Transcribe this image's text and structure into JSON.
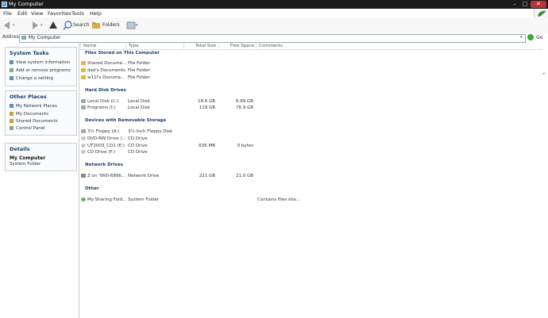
{
  "window": {
    "title": "My Computer"
  },
  "menu": [
    "File",
    "Edit",
    "View",
    "Favorites",
    "Tools",
    "Help"
  ],
  "toolbar": {
    "search_label": "Search",
    "folders_label": "Folders"
  },
  "address": {
    "label": "Address",
    "value": "My Computer",
    "go_label": "Go"
  },
  "left_pane": {
    "system_tasks": {
      "title": "System Tasks",
      "items": [
        "View system information",
        "Add or remove programs",
        "Change a setting"
      ]
    },
    "other_places": {
      "title": "Other Places",
      "items": [
        "My Network Places",
        "My Documents",
        "Shared Documents",
        "Control Panel"
      ]
    },
    "details": {
      "title": "Details",
      "name": "My Computer",
      "type": "System Folder"
    }
  },
  "columns": [
    "Name",
    "Type",
    "Total Size",
    "Free Space",
    "Comments"
  ],
  "groups": [
    {
      "title": "Files Stored on This Computer",
      "rows": [
        {
          "name": "Shared Docume...",
          "type": "File Folder",
          "total": "",
          "free": "",
          "comments": ""
        },
        {
          "name": "dad's Documents",
          "type": "File Folder",
          "total": "",
          "free": "",
          "comments": ""
        },
        {
          "name": "w11l's Docume...",
          "type": "File Folder",
          "total": "",
          "free": "",
          "comments": ""
        }
      ]
    },
    {
      "title": "Hard Disk Drives",
      "rows": [
        {
          "name": "Local Disk (C:)",
          "type": "Local Disk",
          "total": "18.6 GB",
          "free": "6.89 GB",
          "comments": ""
        },
        {
          "name": "Programs (I:)",
          "type": "Local Disk",
          "total": "119 GB",
          "free": "76.9 GB",
          "comments": ""
        }
      ]
    },
    {
      "title": "Devices with Removable Storage",
      "rows": [
        {
          "name": "3½ Floppy (A:)",
          "type": "3½-Inch Floppy Disk",
          "total": "",
          "free": "",
          "comments": ""
        },
        {
          "name": "DVD-RW Drive (...",
          "type": "CD Drive",
          "total": "",
          "free": "",
          "comments": ""
        },
        {
          "name": "UT2003_CD1 (E:)",
          "type": "CD Drive",
          "total": "636 MB",
          "free": "0 bytes",
          "comments": ""
        },
        {
          "name": "CD Drive (F:)",
          "type": "CD Drive",
          "total": "",
          "free": "",
          "comments": ""
        }
      ]
    },
    {
      "title": "Network Drives",
      "rows": [
        {
          "name": "Z on 'Willi-689b...",
          "type": "Network Drive",
          "total": "221 GB",
          "free": "21.0 GB",
          "comments": ""
        }
      ]
    },
    {
      "title": "Other",
      "rows": [
        {
          "name": "My Sharing Fold...",
          "type": "System Folder",
          "total": "",
          "free": "",
          "comments": "Contains files sha..."
        }
      ]
    }
  ]
}
